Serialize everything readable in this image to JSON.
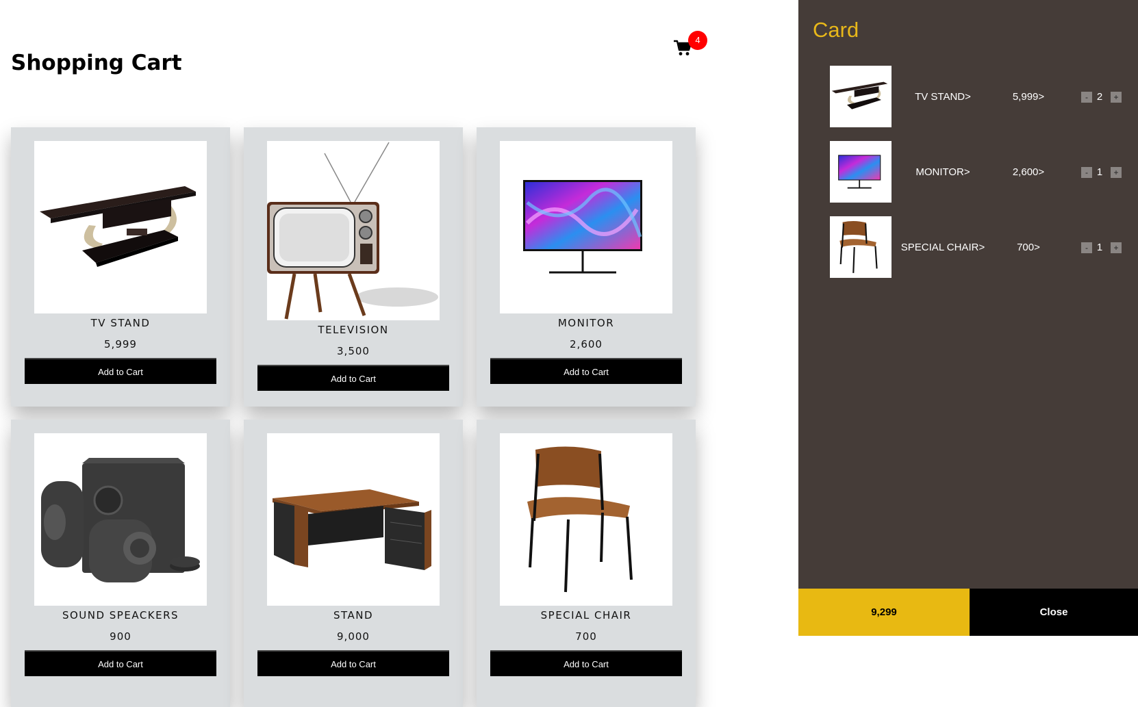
{
  "page_title": "Shopping Cart",
  "cart_badge_count": "4",
  "products": [
    {
      "name": "TV STAND",
      "price": "5,999",
      "button": "Add to Cart",
      "icon": "tv-stand-image"
    },
    {
      "name": "TELEVISION",
      "price": "3,500",
      "button": "Add to Cart",
      "icon": "television-image"
    },
    {
      "name": "MONITOR",
      "price": "2,600",
      "button": "Add to Cart",
      "icon": "monitor-image"
    },
    {
      "name": "SOUND SPEACKERS",
      "price": "900",
      "button": "Add to Cart",
      "icon": "speakers-image"
    },
    {
      "name": "STAND",
      "price": "9,000",
      "button": "Add to Cart",
      "icon": "desk-image"
    },
    {
      "name": "SPECIAL CHAIR",
      "price": "700",
      "button": "Add to Cart",
      "icon": "chair-image"
    }
  ],
  "side_panel": {
    "title": "Card",
    "items": [
      {
        "name": "TV STAND>",
        "price": "5,999>",
        "qty": "2",
        "minus": "-",
        "plus": "+"
      },
      {
        "name": "MONITOR>",
        "price": "2,600>",
        "qty": "1",
        "minus": "-",
        "plus": "+"
      },
      {
        "name": "SPECIAL CHAIR>",
        "price": "700>",
        "qty": "1",
        "minus": "-",
        "plus": "+"
      }
    ],
    "total": "9,299",
    "close_label": "Close"
  },
  "colors": {
    "panel_bg": "#453c38",
    "accent": "#e8b912",
    "badge": "#ff0000",
    "card_bg": "#dadddf"
  }
}
